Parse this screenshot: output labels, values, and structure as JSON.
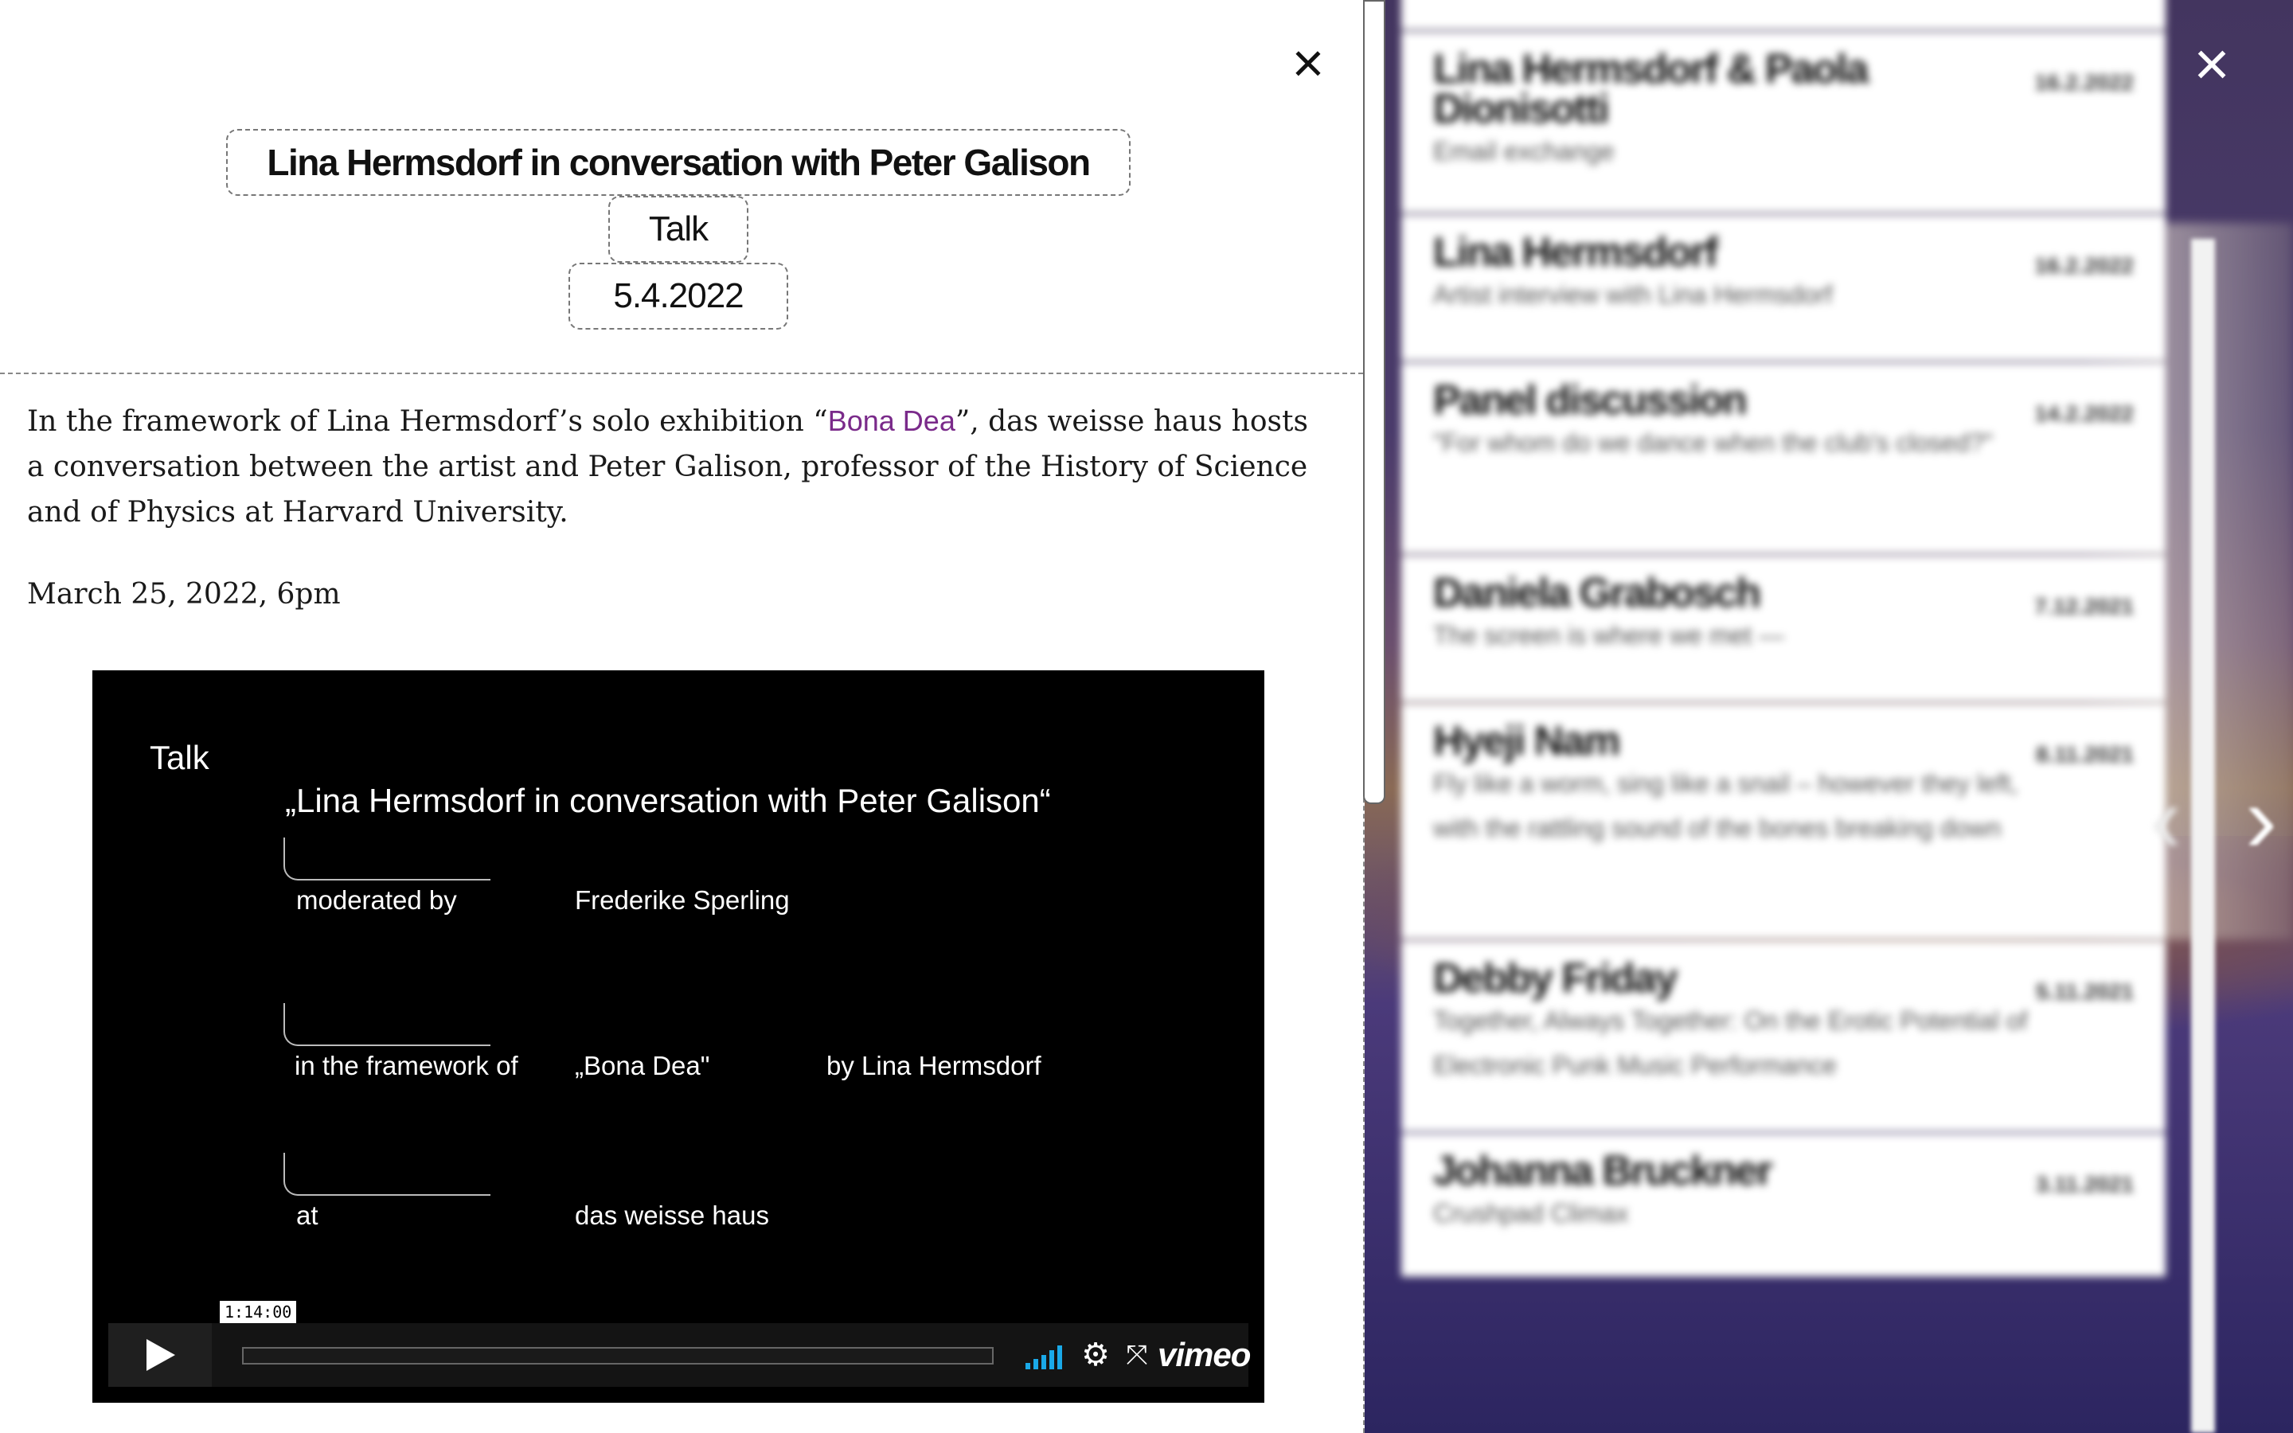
{
  "modal": {
    "close_label": "×",
    "title": "Lina Hermsdorf in conversation with Peter Galison",
    "type": "Talk",
    "date": "5.4.2022",
    "body": {
      "p1_before": "In the framework of Lina Hermsdorf’s solo exhibition “",
      "p1_link": "Bona Dea",
      "p1_after": "”, das weisse haus hosts a conversation between the artist and Peter Galison, professor of the History of Science and of Physics at Harvard University.",
      "p2": "March 25, 2022, 6pm"
    }
  },
  "video": {
    "label_talk": "Talk",
    "headline": "„Lina Hermsdorf in conversation with Peter Galison“",
    "row1_label": "moderated by",
    "row1_value": "Frederike Sperling",
    "row2_label": "in the framework of",
    "row2_value": "„Bona Dea\"",
    "row2_extra": "by Lina Hermsdorf",
    "row3_label": "at",
    "row3_value": "das weisse haus",
    "timecode": "1:14:00",
    "brand": "vimeo",
    "volume_level": 1.0
  },
  "event_list": [
    {
      "title": "Lina Hermsdorf & Paola Dionisotti",
      "date": "16.2.2022",
      "subtitle": "Email exchange"
    },
    {
      "title": "Lina Hermsdorf",
      "date": "16.2.2022",
      "subtitle": "Artist interview with Lina Hermsdorf"
    },
    {
      "title": "Panel discussion",
      "date": "14.2.2022",
      "subtitle": "\"For whom do we dance when the club's closed?\""
    },
    {
      "title": "Daniela Grabosch",
      "date": "7.12.2021",
      "subtitle": "The screen is where we met —"
    },
    {
      "title": "Hyeji Nam",
      "date": "8.11.2021",
      "subtitle": "Fly like a worm, sing like a snail – however they left, with the rattling sound of the bones breaking down"
    },
    {
      "title": "Debby Friday",
      "date": "5.11.2021",
      "subtitle": "Together, Always Together: On the Erotic Potential of Electronic Punk Music Performance"
    },
    {
      "title": "Johanna Bruckner",
      "date": "3.11.2021",
      "subtitle": "Crushpad Climax"
    }
  ],
  "outer": {
    "close_label": "×",
    "prev_label": "‹",
    "next_label": "›"
  }
}
